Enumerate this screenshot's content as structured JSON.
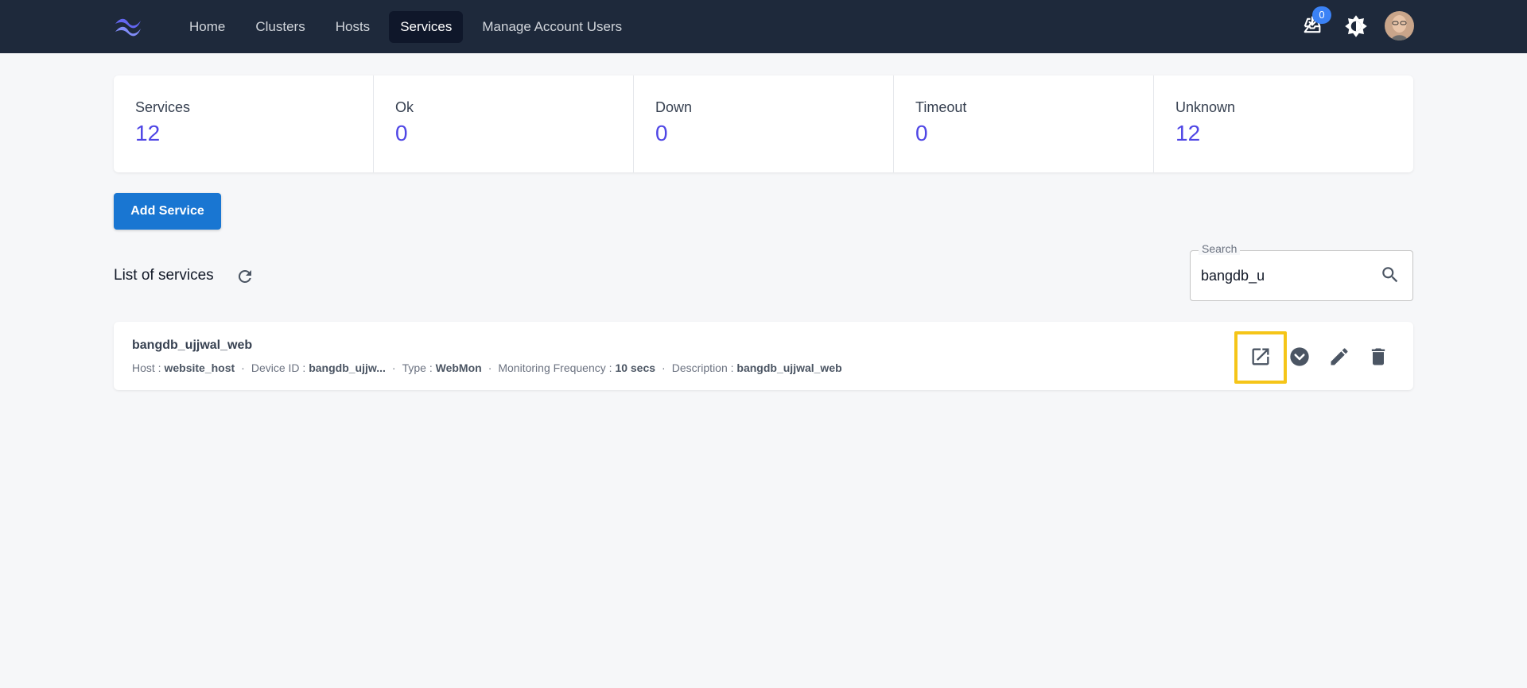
{
  "nav": {
    "items": [
      {
        "label": "Home",
        "active": false
      },
      {
        "label": "Clusters",
        "active": false
      },
      {
        "label": "Hosts",
        "active": false
      },
      {
        "label": "Services",
        "active": true
      },
      {
        "label": "Manage Account Users",
        "active": false
      }
    ],
    "inbox_badge": "0",
    "icons": {
      "logo": "tailwind-logo",
      "inbox": "inbox-download-icon",
      "theme": "brightness-icon",
      "avatar": "user-avatar"
    }
  },
  "stats": [
    {
      "label": "Services",
      "value": "12"
    },
    {
      "label": "Ok",
      "value": "0"
    },
    {
      "label": "Down",
      "value": "0"
    },
    {
      "label": "Timeout",
      "value": "0"
    },
    {
      "label": "Unknown",
      "value": "12"
    }
  ],
  "actions": {
    "add_service_label": "Add Service"
  },
  "list": {
    "title": "List of services"
  },
  "search": {
    "legend": "Search",
    "value": "bangdb_u"
  },
  "services": [
    {
      "name": "bangdb_ujjwal_web",
      "host_label": "Host :",
      "host": "website_host",
      "device_label": "Device ID :",
      "device": "bangdb_ujjw...",
      "type_label": "Type :",
      "type": "WebMon",
      "freq_label": "Monitoring Frequency :",
      "freq": "10 secs",
      "desc_label": "Description :",
      "desc": "bangdb_ujjwal_web",
      "separator": "·"
    }
  ],
  "colors": {
    "topbar": "#1e293b",
    "accent": "#4f46e5",
    "primary_button": "#1976d2",
    "highlight": "#f5c518"
  }
}
